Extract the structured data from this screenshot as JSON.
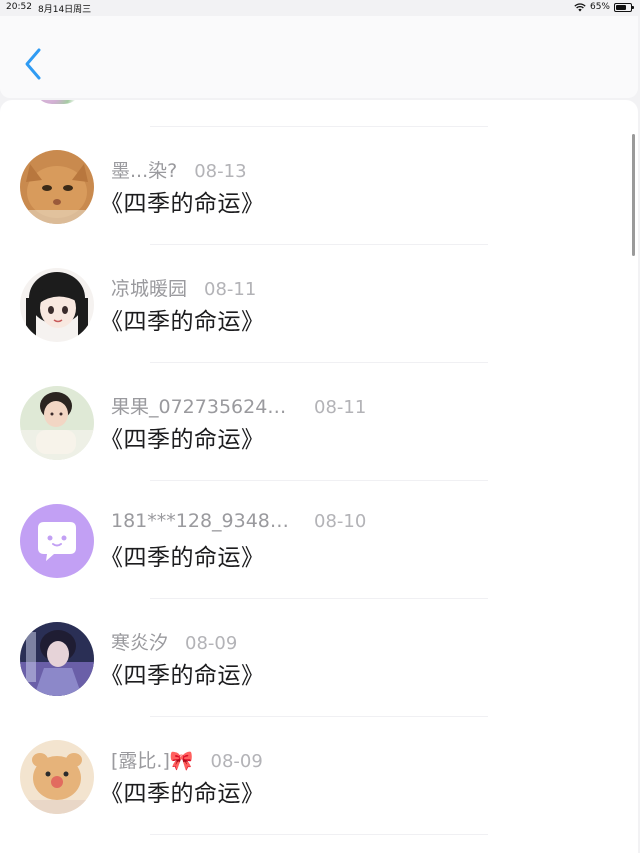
{
  "status_bar": {
    "time": "20:52",
    "date": "8月14日周三",
    "battery": "65%",
    "battery_level": 0.65
  },
  "header": {
    "back_icon": "chevron-left-icon",
    "accent_color": "#2f9bf3"
  },
  "items": [
    {
      "username": "墨...染?",
      "date": "08-13",
      "title": "《四季的命运》",
      "avatar": "orange-cat"
    },
    {
      "username": "凉城暖园",
      "date": "08-11",
      "title": "《四季的命运》",
      "avatar": "anime-girl"
    },
    {
      "username": "果果_0727356244...",
      "date": "08-11",
      "title": "《四季的命运》",
      "avatar": "photo-girl"
    },
    {
      "username": "181***128_934871...",
      "date": "08-10",
      "title": "《四季的命运》",
      "avatar": "default-chat-icon"
    },
    {
      "username": "寒炎汐",
      "date": "08-09",
      "title": "《四季的命运》",
      "avatar": "anime-character"
    },
    {
      "username": "[露比.]🎀",
      "date": "08-09",
      "title": "《四季的命运》",
      "avatar": "plush-toy"
    }
  ]
}
